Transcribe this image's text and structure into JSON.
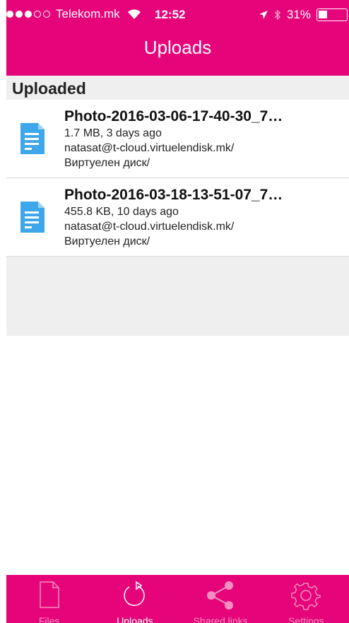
{
  "status_bar": {
    "carrier": "Telekom.mk",
    "time": "12:52",
    "battery": "31%",
    "battery_level": 0.31
  },
  "nav": {
    "title": "Uploads"
  },
  "section": {
    "title": "Uploaded"
  },
  "uploads": [
    {
      "name": "Photo-2016-03-06-17-40-30_7…",
      "size_age": "1.7 MB, 3 days ago",
      "account": "natasat@t-cloud.virtuelendisk.mk/",
      "folder": "Виртуелен диск/"
    },
    {
      "name": "Photo-2016-03-18-13-51-07_7…",
      "size_age": "455.8 KB, 10 days ago",
      "account": "natasat@t-cloud.virtuelendisk.mk/",
      "folder": "Виртуелен диск/"
    }
  ],
  "tabs": [
    {
      "label": "Files",
      "icon": "file-icon",
      "active": false
    },
    {
      "label": "Uploads",
      "icon": "refresh-icon",
      "active": true
    },
    {
      "label": "Shared links",
      "icon": "share-icon",
      "active": false
    },
    {
      "label": "Settings",
      "icon": "gear-icon",
      "active": false
    }
  ],
  "colors": {
    "brand": "#e6047a",
    "file_icon": "#3ea6ea",
    "tab_inactive": "#f38ec2",
    "section_bg": "#efefef"
  }
}
